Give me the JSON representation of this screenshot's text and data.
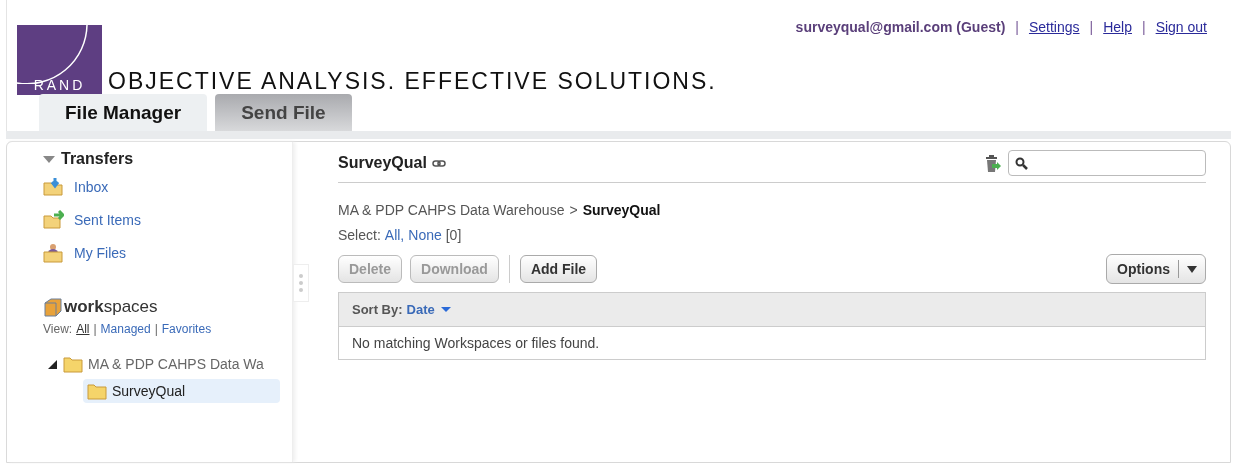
{
  "user_bar": {
    "account": "surveyqual@gmail.com (Guest)",
    "links": [
      {
        "separator": "|",
        "label": "Settings"
      },
      {
        "separator": "|",
        "label": "Help"
      },
      {
        "separator": "|",
        "label": "Sign out"
      }
    ]
  },
  "logo": {
    "mark": "RAND",
    "tagline": "OBJECTIVE ANALYSIS. EFFECTIVE SOLUTIONS."
  },
  "tabs": [
    {
      "label": "File Manager",
      "selected": true
    },
    {
      "label": "Send File",
      "selected": false
    }
  ],
  "sidebar": {
    "transfers": {
      "title": "Transfers",
      "expanded": true,
      "items": [
        {
          "label": "Inbox",
          "kind": "inbox"
        },
        {
          "label": "Sent Items",
          "kind": "sent"
        },
        {
          "label": "My Files",
          "kind": "myfiles"
        }
      ]
    },
    "workspaces": {
      "title": "**work**spaces",
      "view_label": "View:",
      "views": [
        {
          "label": "All",
          "selected": true
        },
        {
          "separator": "|",
          "label": "Managed",
          "selected": false
        },
        {
          "separator": "|",
          "label": "Favorites",
          "selected": false
        }
      ],
      "tree": [
        {
          "label": "MA & PDP CAHPS Data Wa",
          "expanded": true,
          "selected": false,
          "children": [
            {
              "label": "SurveyQual",
              "selected": true
            }
          ]
        }
      ]
    }
  },
  "main": {
    "title": "SurveyQual",
    "breadcrumb": [
      "MA & PDP CAHPS Data Warehouse",
      ">",
      "SurveyQual"
    ],
    "select": {
      "label": "Select:",
      "all": "All,",
      "none": "None",
      "count": "[0]"
    },
    "buttons": [
      {
        "label": "Delete",
        "disabled": true
      },
      {
        "label": "Download",
        "disabled": true
      },
      {
        "label": "Add File",
        "disabled": false
      }
    ],
    "options": "Options",
    "sort_label": "Sort By:",
    "sort_value": "Date",
    "empty_message": "No matching Workspaces or files found."
  }
}
